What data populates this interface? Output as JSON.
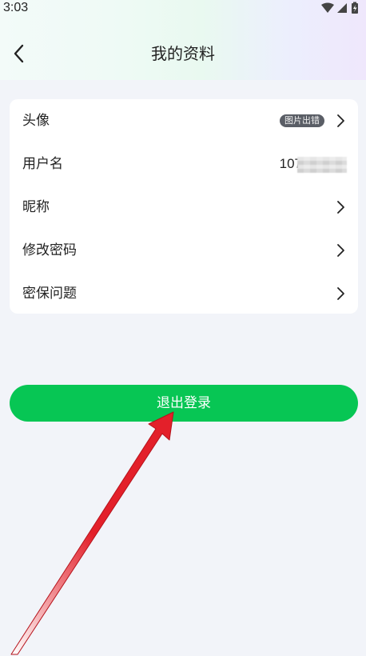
{
  "status_bar": {
    "time": "3:03"
  },
  "header": {
    "title": "我的资料"
  },
  "profile": {
    "rows": [
      {
        "label": "头像",
        "avatar_text": "图片出错"
      },
      {
        "label": "用户名",
        "value": "107"
      },
      {
        "label": "昵称"
      },
      {
        "label": "修改密码"
      },
      {
        "label": "密保问题"
      }
    ]
  },
  "logout": {
    "label": "退出登录",
    "color": "#07c654"
  },
  "annotation": {
    "arrow_color": "#e3202a"
  }
}
